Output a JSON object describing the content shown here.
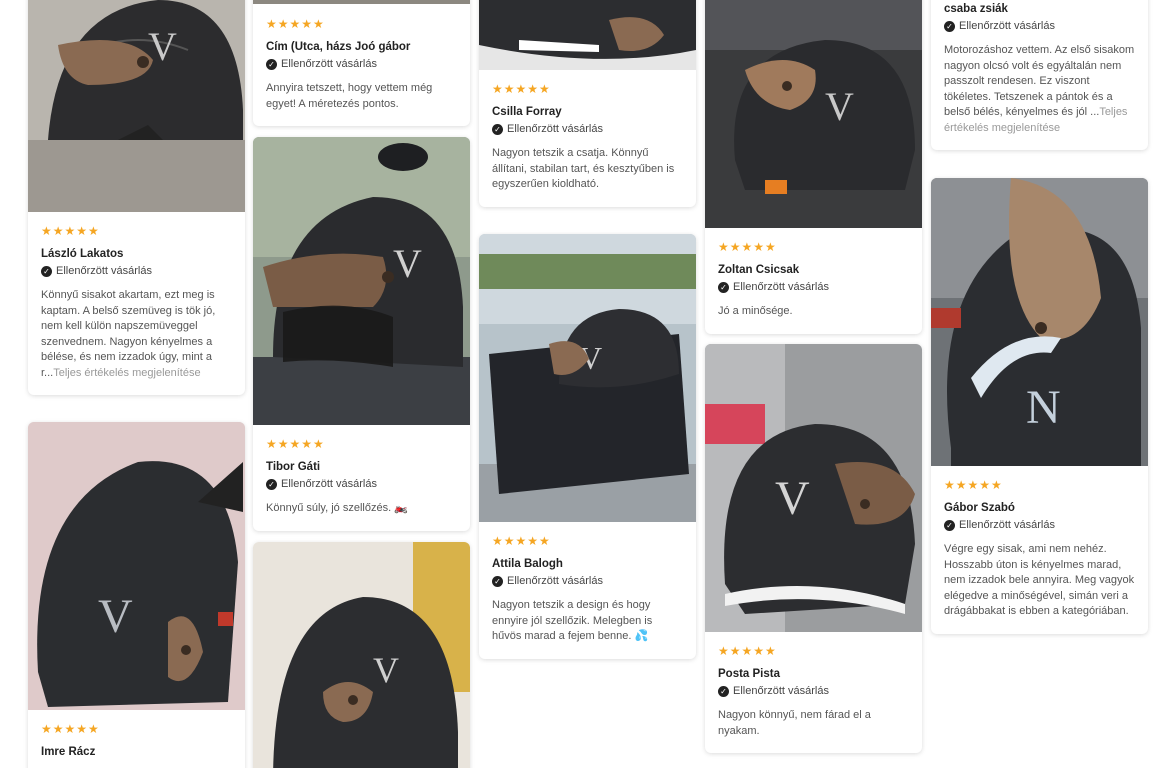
{
  "badges": {
    "verified_label": "Ellenőrzött vásárlás",
    "stars": "★★★★★"
  },
  "reviews": [
    {
      "name": "László Lakatos",
      "text": "Könnyű sisakot akartam, ezt meg is kaptam. A belső szemüveg is tök jó, nem kell külön napszemüveggel szenvednem. Nagyon kényelmes a bélése, és nem izzadok úgy, mint a r...",
      "more": "Teljes értékelés megjelenítése"
    },
    {
      "name": "Imre Rácz"
    },
    {
      "name": "Cím (Utca, házs Joó gábor",
      "text": "Annyira tetszett, hogy vettem még egyet! A méretezés pontos."
    },
    {
      "name": "Tibor Gáti",
      "text": "Könnyű súly, jó szellőzés.",
      "emoji": "🏍️"
    },
    {
      "name": "Csilla Forray",
      "text": "Nagyon tetszik a csatja. Könnyű állítani, stabilan tart, és kesztyűben is egyszerűen kioldható."
    },
    {
      "name": "Attila Balogh",
      "text": "Nagyon tetszik a design és hogy ennyire jól szellőzik. Melegben is hűvös marad a fejem benne.",
      "emoji": "💦"
    },
    {
      "name": "Zoltan Csicsak",
      "text": "Jó a minősége."
    },
    {
      "name": "Posta Pista",
      "text": "Nagyon könnyű, nem fárad el a nyakam."
    },
    {
      "name": "csaba zsiák",
      "text": "Motorozáshoz vettem. Az első sisakom nagyon olcsó volt és egyáltalán nem passzolt rendesen. Ez viszont tökéletes. Tetszenek a pántok és a belső bélés, kényelmes és jól ...",
      "more": "Teljes értékelés megjelenítése"
    },
    {
      "name": "Gábor Szabó",
      "text": "Végre egy sisak, ami nem nehéz. Hosszabb úton is kényelmes marad, nem izzadok bele annyira. Meg vagyok elégedve a minőségével, simán veri a drágábbakat is ebben a kategóriában."
    }
  ]
}
